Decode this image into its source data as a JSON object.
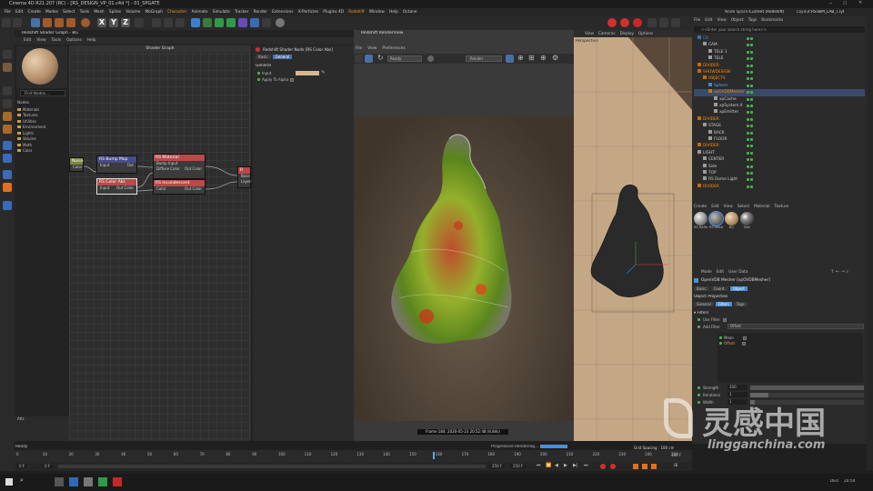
{
  "window": {
    "title": "Cinema 4D R21.207 (RC) - [RS_DESIGN_VP_01.c4d *] - 01_SPGATE",
    "node_space_label": "Node Space:",
    "node_space_value": "Current (Redshift)",
    "layout_label": "Layout:",
    "layout_value": "RSTwM_LAB_T.lyt"
  },
  "menubar": [
    "File",
    "Edit",
    "Create",
    "Modes",
    "Select",
    "Tools",
    "Mesh",
    "Spline",
    "Volume",
    "MoGraph",
    "Character",
    "Animate",
    "Simulate",
    "Tracker",
    "Render",
    "Extensions",
    "X-Particles",
    "Plugins 4D",
    "Redshift",
    "Window",
    "Help",
    "Octane"
  ],
  "shader_graph": {
    "window_title": "Redshift Shader Graph - BG",
    "menu": [
      "Edit",
      "View",
      "Tools",
      "Options",
      "Help"
    ],
    "graph_title": "Shader Graph",
    "find_nodes": "Find Nodes...",
    "nodes_header": "Nodes",
    "categories": [
      "Materials",
      "Textures",
      "Utilities",
      "Environment",
      "Lights",
      "Volume",
      "Math",
      "Color"
    ],
    "graph_nodes": [
      {
        "title": "RS Bump Map",
        "ports": [
          "Input",
          "Out"
        ]
      },
      {
        "title": "RS Material",
        "ports": [
          "Bump Input",
          "Diffuse Color",
          "Out Color"
        ]
      },
      {
        "title": "RS Color Abs",
        "ports": [
          "Input",
          "Out Color"
        ]
      },
      {
        "title": "RS Incandescent",
        "ports": [
          "Color",
          "Out Color"
        ]
      },
      {
        "title": "Noise",
        "ports": [
          "Color"
        ]
      },
      {
        "title": "R",
        "ports": [
          "Base",
          "Layer"
        ]
      }
    ],
    "info_label": "Attr."
  },
  "attr_panel": {
    "node_title": "Redshift Shader Node [RS Color Abs]",
    "tabs": [
      "Basic",
      "General"
    ],
    "section": "General",
    "input_label": "Input",
    "apply_alpha_label": "Apply To Alpha"
  },
  "renderview": {
    "title": "Redshift RenderView",
    "menu": [
      "File",
      "View",
      "Preferences"
    ],
    "status": "Ready",
    "render_dropdown": "Render",
    "frame_info": "Frame 184: 2020-05-23 20:52:48 (6.84s)",
    "progress_label": "Progressive Rendering..."
  },
  "viewport": {
    "menu": [
      "View",
      "Cameras",
      "Display",
      "Options"
    ],
    "name": "Perspective",
    "grid_spacing": "Grid Spacing : 100 cm"
  },
  "objects": {
    "menu": [
      "File",
      "Edit",
      "View",
      "Object",
      "Tags",
      "Bookmarks"
    ],
    "search_placeholder": "<<Enter your search string here>>",
    "rows": [
      {
        "name": "CA",
        "indent": 0,
        "color": "#4a90d9"
      },
      {
        "name": "CAM",
        "indent": 1,
        "color": "#cccccc"
      },
      {
        "name": "TELE 1",
        "indent": 2,
        "color": "#cccccc"
      },
      {
        "name": "TELE",
        "indent": 2,
        "color": "#cccccc"
      },
      {
        "name": "DIVIDER",
        "indent": 0,
        "color": "#ff8a00"
      },
      {
        "name": "SHOWDESIGN",
        "indent": 0,
        "color": "#ff8a00"
      },
      {
        "name": "OBJECTS",
        "indent": 1,
        "color": "#ff8a00"
      },
      {
        "name": "Sphere",
        "indent": 2,
        "color": "#5aa9ff"
      },
      {
        "name": "xpOVDBMesher",
        "indent": 2,
        "color": "#ff8a00"
      },
      {
        "name": "xpCache",
        "indent": 3,
        "color": "#cccccc"
      },
      {
        "name": "xpSystem.4",
        "indent": 3,
        "color": "#cccccc"
      },
      {
        "name": "xpEmitter",
        "indent": 3,
        "color": "#cccccc"
      },
      {
        "name": "DIVIDER",
        "indent": 0,
        "color": "#ff8a00"
      },
      {
        "name": "STAGE",
        "indent": 1,
        "color": "#cccccc"
      },
      {
        "name": "BACK",
        "indent": 2,
        "color": "#cccccc"
      },
      {
        "name": "FLOOR",
        "indent": 2,
        "color": "#cccccc"
      },
      {
        "name": "DIVIDER",
        "indent": 0,
        "color": "#ff8a00"
      },
      {
        "name": "LIGHT",
        "indent": 0,
        "color": "#cccccc"
      },
      {
        "name": "CENTER",
        "indent": 1,
        "color": "#cccccc"
      },
      {
        "name": "Side",
        "indent": 1,
        "color": "#cccccc"
      },
      {
        "name": "TOP",
        "indent": 1,
        "color": "#cccccc"
      },
      {
        "name": "RS Dome Light",
        "indent": 1,
        "color": "#cccccc"
      },
      {
        "name": "DIVIDER",
        "indent": 0,
        "color": "#ff8a00"
      }
    ]
  },
  "materials": {
    "menu": [
      "Create",
      "Edit",
      "View",
      "Select",
      "Material",
      "Texture"
    ],
    "items": [
      "RS Refle",
      "RS Matte",
      "BG",
      "Mat"
    ]
  },
  "attributes": {
    "menu": [
      "Mode",
      "Edit",
      "User Data"
    ],
    "object_title": "OpenVDB Mesher [xpOVDBMesher]",
    "tabs": [
      "Basic",
      "Coord.",
      "Object"
    ],
    "section_title": "Object Properties",
    "subtabs": [
      "General",
      "Filters",
      "Tags"
    ],
    "filters_header": "Filters",
    "use_filter_label": "Use Filter",
    "add_filter_label": "Add Filter",
    "add_filter_value": "Offset",
    "filter_list": [
      "Mean",
      "Offset"
    ],
    "strength_label": "Strength",
    "strength_value": "100",
    "iterations_label": "Iterations",
    "iterations_value": "1",
    "width_label": "Width",
    "width_value": "1"
  },
  "timeline": {
    "ticks": [
      "0",
      "10",
      "20",
      "30",
      "40",
      "50",
      "60",
      "70",
      "80",
      "90",
      "100",
      "110",
      "120",
      "130",
      "140",
      "150",
      "160",
      "170",
      "180",
      "190",
      "200",
      "210",
      "220",
      "230",
      "240",
      "250"
    ],
    "current_frame": "184 F",
    "start_field": "0 F",
    "end_field_a": "250 F",
    "end_field_b": "250 F",
    "frame_label": "0 F",
    "current_field": "184 F"
  },
  "statusbar": {
    "text": "Ready"
  },
  "taskbar": {
    "time": "20:54",
    "lang": "DEU"
  },
  "watermark": {
    "line1": "灵感中国",
    "line2": "lingganchina.com"
  }
}
